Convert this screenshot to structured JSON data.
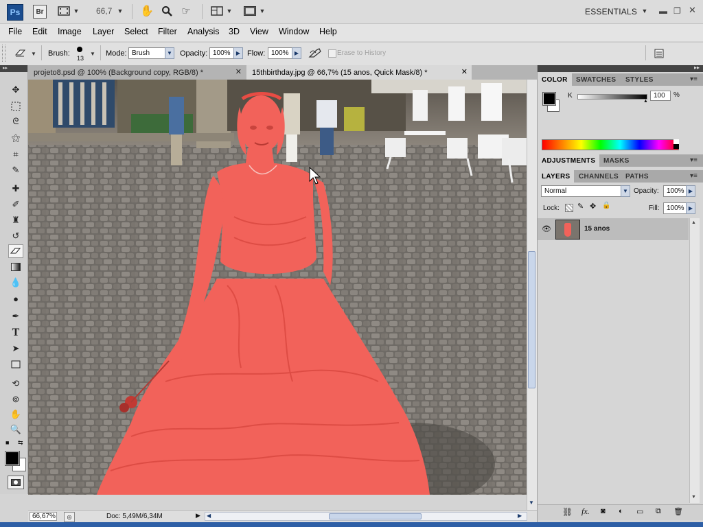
{
  "appbar": {
    "logo": "Ps",
    "bridge": "Br",
    "zoom": "66,7",
    "workspace": "ESSENTIALS"
  },
  "menu": [
    "File",
    "Edit",
    "Image",
    "Layer",
    "Select",
    "Filter",
    "Analysis",
    "3D",
    "View",
    "Window",
    "Help"
  ],
  "options": {
    "brush_label": "Brush:",
    "brush_size": "13",
    "mode_label": "Mode:",
    "mode_value": "Brush",
    "opacity_label": "Opacity:",
    "opacity_value": "100%",
    "flow_label": "Flow:",
    "flow_value": "100%",
    "erase_history": "Erase to History"
  },
  "tabs": [
    {
      "label": "projeto8.psd @ 100% (Background copy, RGB/8) *"
    },
    {
      "label": "15thbirthday.jpg @ 66,7% (15 anos, Quick Mask/8) *"
    }
  ],
  "status": {
    "zoom": "66,67%",
    "doc": "Doc: 5,49M/6,34M"
  },
  "panels": {
    "color_tabs": [
      "COLOR",
      "SWATCHES",
      "STYLES"
    ],
    "k_label": "K",
    "k_value": "100",
    "k_unit": "%",
    "adjust_tabs": [
      "ADJUSTMENTS",
      "MASKS"
    ],
    "layer_tabs": [
      "LAYERS",
      "CHANNELS",
      "PATHS"
    ],
    "blend_mode": "Normal",
    "opacity_label": "Opacity:",
    "opacity_value": "100%",
    "lock_label": "Lock:",
    "fill_label": "Fill:",
    "fill_value": "100%",
    "layer_name": "15 anos"
  },
  "icons": {
    "close": "close-icon",
    "eye": "eye-icon"
  }
}
